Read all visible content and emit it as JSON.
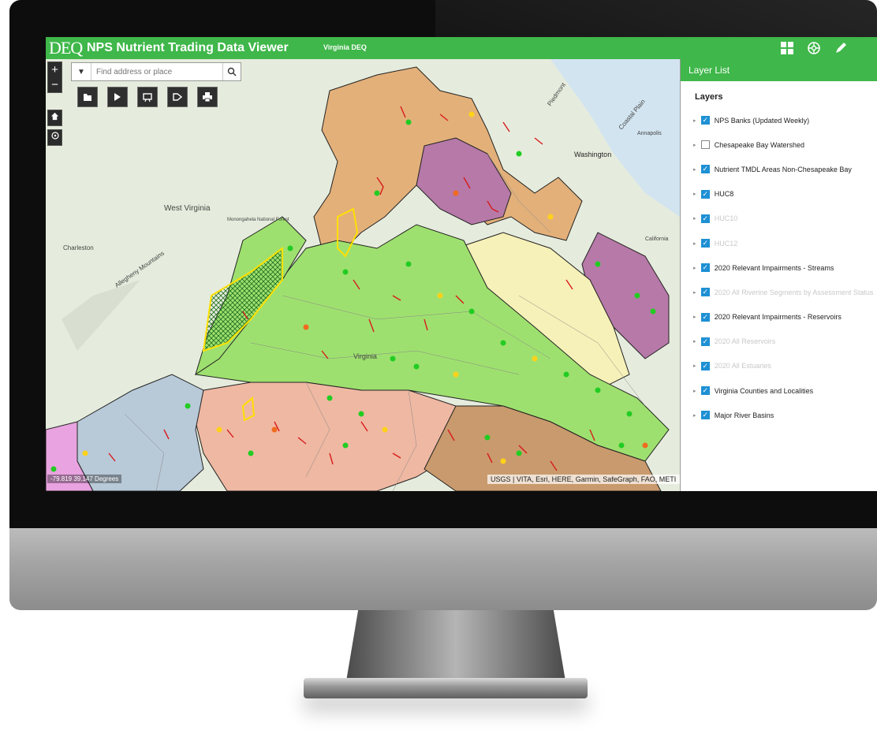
{
  "app": {
    "logo": "DEQ",
    "title": "NPS Nutrient Trading Data Viewer",
    "subtitle": "Virginia DEQ"
  },
  "header_icons": [
    "grid-icon",
    "basemap-icon",
    "edit-icon"
  ],
  "search": {
    "placeholder": "Find address or place"
  },
  "map_controls": {
    "zoom_in": "+",
    "zoom_out": "−"
  },
  "tools": [
    "layers-icon",
    "legend-icon",
    "measure-icon",
    "query-icon",
    "print-icon"
  ],
  "map_labels": {
    "west_virginia": "West Virginia",
    "charleston": "Charleston",
    "allegheny": "Allegheny Mountains",
    "washington": "Washington",
    "annapolis": "Annapolis",
    "coastal_plain": "Coastal Plain",
    "piedmont": "Piedmont",
    "monongahela": "Monongahela National Forest",
    "california": "California",
    "virginia": "Virginia"
  },
  "status": {
    "coordinates": "-79.819 39.147 Degrees",
    "attribution": "USGS | VITA, Esri, HERE, Garmin, SafeGraph, FAO, METI"
  },
  "layer_panel": {
    "title": "Layer List",
    "subtitle": "Layers",
    "layers": [
      {
        "label": "NPS Banks (Updated Weekly)",
        "checked": true,
        "dim": false
      },
      {
        "label": "Chesapeake Bay Watershed",
        "checked": false,
        "dim": false
      },
      {
        "label": "Nutrient TMDL Areas Non-Chesapeake Bay",
        "checked": true,
        "dim": false
      },
      {
        "label": "HUC8",
        "checked": true,
        "dim": false
      },
      {
        "label": "HUC10",
        "checked": true,
        "dim": true
      },
      {
        "label": "HUC12",
        "checked": true,
        "dim": true
      },
      {
        "label": "2020 Relevant Impairments - Streams",
        "checked": true,
        "dim": false
      },
      {
        "label": "2020 All Riverine Segments by Assessment Status",
        "checked": true,
        "dim": true
      },
      {
        "label": "2020 Relevant Impairments - Reservoirs",
        "checked": true,
        "dim": false
      },
      {
        "label": "2020 All Reservoirs",
        "checked": true,
        "dim": true
      },
      {
        "label": "2020 All Estuaries",
        "checked": true,
        "dim": true
      },
      {
        "label": "Virginia Counties and Localities",
        "checked": true,
        "dim": false
      },
      {
        "label": "Major River Basins",
        "checked": true,
        "dim": false
      }
    ]
  },
  "colors": {
    "header_green": "#3fb74a",
    "checkbox_blue": "#1e90d4",
    "bank_green": "#22cc22",
    "bank_yellow": "#ffd21a",
    "bank_orange": "#f06a1f",
    "impairment_red": "#d81b1b"
  }
}
